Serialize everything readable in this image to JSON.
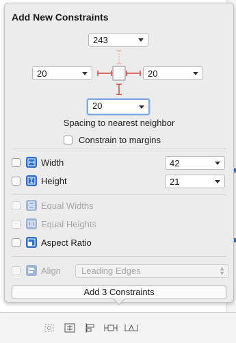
{
  "popover": {
    "title": "Add New Constraints",
    "spacing": {
      "top": "243",
      "left": "20",
      "right": "20",
      "bottom": "20"
    },
    "spacing_helper": "Spacing to nearest neighbor",
    "constrain_to_margins": "Constrain to margins",
    "width": {
      "label": "Width",
      "value": "42"
    },
    "height": {
      "label": "Height",
      "value": "21"
    },
    "equal_widths": "Equal Widths",
    "equal_heights": "Equal Heights",
    "aspect_ratio": "Aspect Ratio",
    "align": {
      "label": "Align",
      "value": "Leading Edges"
    },
    "add_button": "Add 3 Constraints"
  },
  "colors": {
    "accent": "#2f6fd0",
    "constraint_red": "#d9433b",
    "focus_ring": "#7fa9e6"
  },
  "bottom_toolbar": {
    "icons": [
      "update-frames-icon",
      "embed-in-stack-icon",
      "align-icon",
      "add-constraints-icon",
      "resolve-issues-icon"
    ]
  }
}
